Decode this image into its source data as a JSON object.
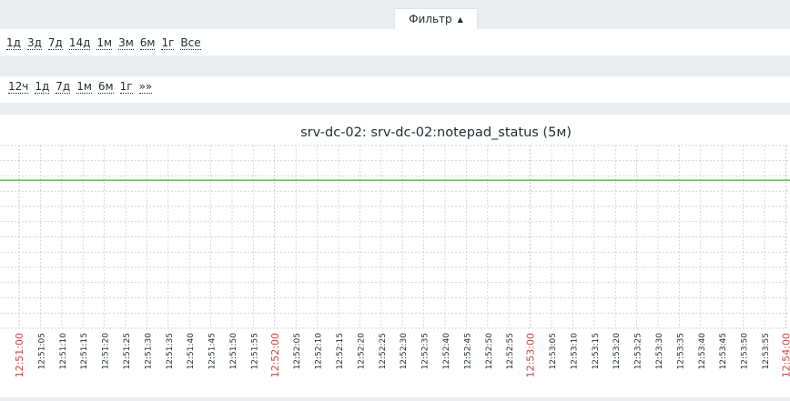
{
  "filter": {
    "label": "Фильтр",
    "toggle_icon": "triangle-up-icon"
  },
  "zoom_periods": [
    "1д",
    "3д",
    "7д",
    "14д",
    "1м",
    "3м",
    "6м",
    "1г",
    "Все"
  ],
  "nav_periods": [
    "12ч",
    "1д",
    "7д",
    "1м",
    "6м",
    "1г",
    "»»"
  ],
  "chart_data": {
    "type": "line",
    "title": "srv-dc-02: srv-dc-02:notepad_status (5м)",
    "x_ticks": [
      "12:51:00",
      "12:51:05",
      "12:51:10",
      "12:51:15",
      "12:51:20",
      "12:51:25",
      "12:51:30",
      "12:51:35",
      "12:51:40",
      "12:51:45",
      "12:51:50",
      "12:51:55",
      "12:52:00",
      "12:52:05",
      "12:52:10",
      "12:52:15",
      "12:52:20",
      "12:52:25",
      "12:52:30",
      "12:52:35",
      "12:52:40",
      "12:52:45",
      "12:52:50",
      "12:52:55",
      "12:53:00",
      "12:53:05",
      "12:53:10",
      "12:53:15",
      "12:53:20",
      "12:53:25",
      "12:53:30",
      "12:53:35",
      "12:53:40",
      "12:53:45",
      "12:53:50",
      "12:53:55",
      "12:54:00"
    ],
    "major_ticks": [
      "12:51:00",
      "12:52:00",
      "12:53:00",
      "12:54:00"
    ],
    "series": [
      {
        "color": "#1aaf1a",
        "level": 0.19
      }
    ],
    "grid": true,
    "colors": {
      "major_tick": "#d9403a",
      "minor_tick": "#1f2c33",
      "grid": "#c8c8c8"
    }
  }
}
